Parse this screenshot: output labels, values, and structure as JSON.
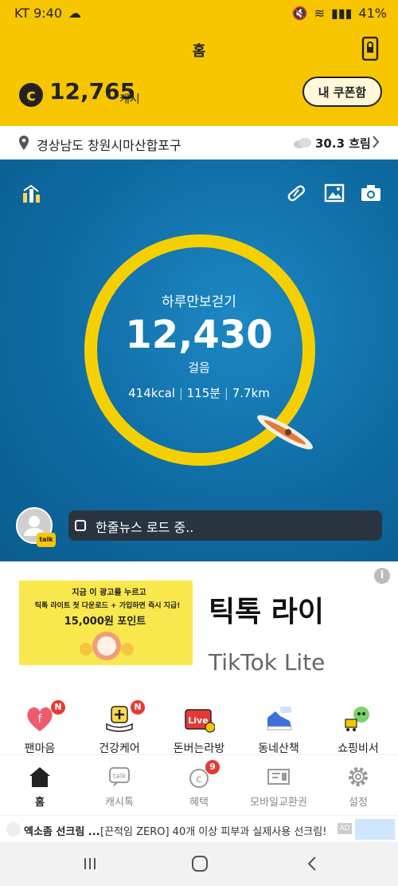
{
  "status": {
    "carrier_time": "KT 9:40",
    "battery": "41%"
  },
  "header": {
    "title": "홈",
    "points": "12,765",
    "points_unit": "캐시",
    "coupon_label": "내 쿠폰함"
  },
  "location": {
    "address": "경상남도 창원시마산합포구",
    "weather": "30.3 흐림"
  },
  "walk": {
    "title": "하루만보걷기",
    "steps": "12,430",
    "unit": "걸음",
    "kcal": "414kcal",
    "minutes": "115분",
    "distance": "7.7km"
  },
  "news": {
    "text": "한줄뉴스 로드 중.."
  },
  "ad": {
    "img_title": "지금 이 광고를 누르고",
    "img_line2": "틱톡 라이트 첫 다운로드 + 가입하면 즉시 지급!",
    "img_points": "15,000원 포인트",
    "big_text": "틱톡 라이",
    "brand": "TikTok Lite"
  },
  "quick_menu": [
    {
      "label": "팬마음",
      "badge": "N"
    },
    {
      "label": "건강케어",
      "badge": "N"
    },
    {
      "label": "돈버는라방",
      "badge": ""
    },
    {
      "label": "동네산책",
      "badge": ""
    },
    {
      "label": "쇼핑비서",
      "badge": ""
    }
  ],
  "nav": [
    {
      "label": "홈",
      "active": true
    },
    {
      "label": "캐시톡"
    },
    {
      "label": "혜택",
      "badge": "9"
    },
    {
      "label": "모바일교환권"
    },
    {
      "label": "설정"
    }
  ],
  "strip_ad": {
    "title": "엑소좀 선크림 ...",
    "text": "[끈적임 ZERO] 40개 이상 피부과 실제사용 선크림!",
    "tag": "AD"
  },
  "colors": {
    "brand_yellow": "#f7c600",
    "hero_blue": "#0e6fa8",
    "ring": "#f5d000",
    "badge_red": "#e53935"
  }
}
